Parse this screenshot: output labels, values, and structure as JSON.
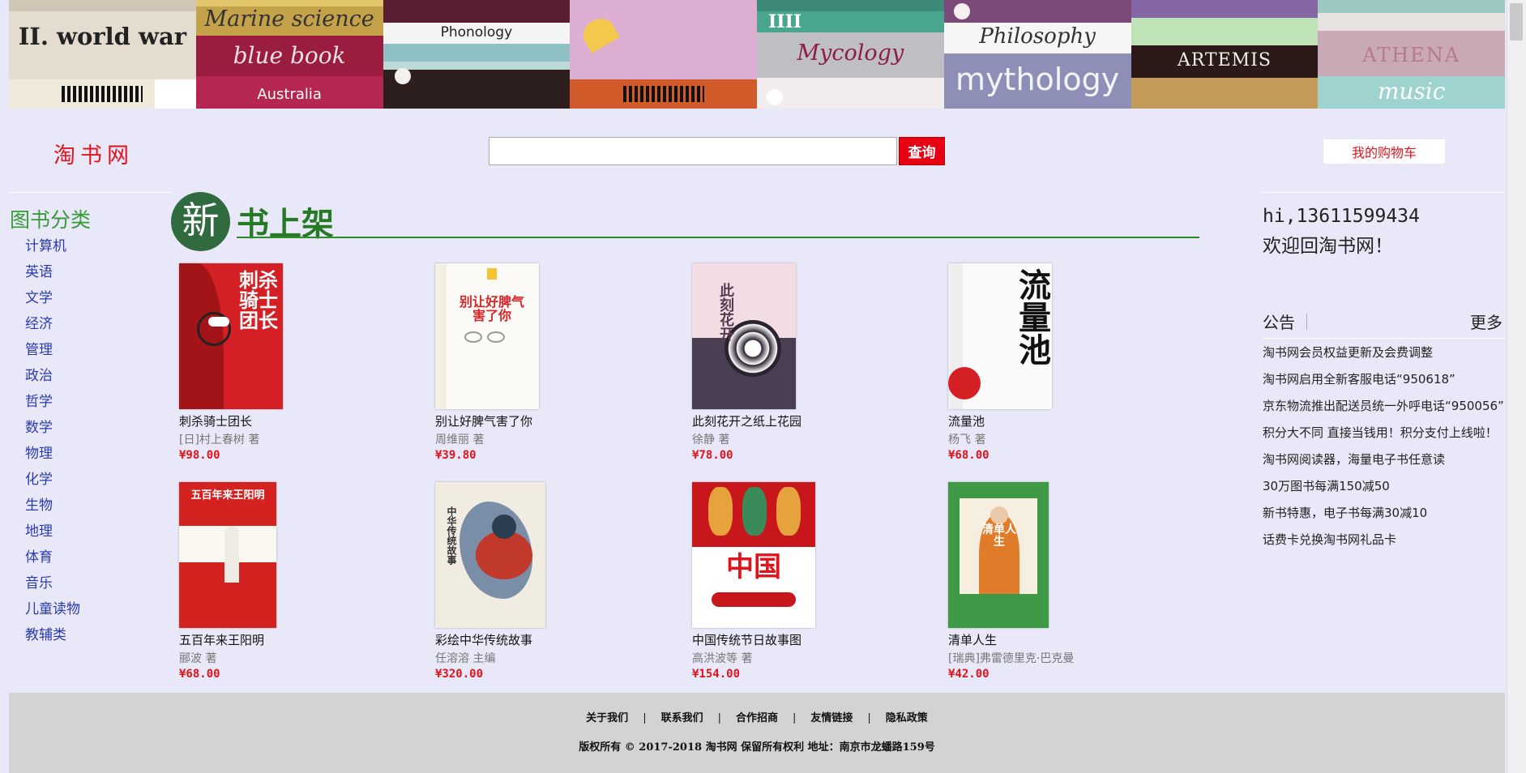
{
  "banner": {
    "books": [
      {
        "main": "II. world war",
        "sub": ""
      },
      {
        "main": "Marine science",
        "sub": "blue book",
        "extra": "Australia"
      },
      {
        "main": "Phonology",
        "sub": ""
      },
      {
        "main": "",
        "sub": ""
      },
      {
        "main": "Mycology",
        "sub": "IIII"
      },
      {
        "main": "Philosophy",
        "sub": "mythology"
      },
      {
        "main": "ARTEMIS",
        "sub": ""
      },
      {
        "main": "ATHENA",
        "sub": "music"
      }
    ]
  },
  "header": {
    "logo": "淘书网",
    "search_placeholder": "",
    "search_button": "查询",
    "cart_button": "我的购物车"
  },
  "sidebar": {
    "title": "图书分类",
    "categories": [
      "计算机",
      "英语",
      "文学",
      "经济",
      "管理",
      "政治",
      "哲学",
      "数学",
      "物理",
      "化学",
      "生物",
      "地理",
      "体育",
      "音乐",
      "儿童读物",
      "教辅类"
    ]
  },
  "shelf": {
    "badge": "新",
    "title": "书上架"
  },
  "books": [
    {
      "title": "刺杀骑士团长",
      "author": "[日]村上春树 著",
      "price": "¥98.00",
      "cover_text": "刺杀骑士团长"
    },
    {
      "title": "别让好脾气害了你",
      "author": "周维丽 著",
      "price": "¥39.80",
      "cover_text": "别让好脾气害了你"
    },
    {
      "title": "此刻花开之纸上花园",
      "author": "徐静 著",
      "price": "¥78.00",
      "cover_text": "此刻花开"
    },
    {
      "title": "流量池",
      "author": "杨飞 著",
      "price": "¥68.00",
      "cover_text": "流量池"
    },
    {
      "title": "五百年来王阳明",
      "author": "郦波 著",
      "price": "¥68.00",
      "cover_text": "五百年来王阳明"
    },
    {
      "title": "彩绘中华传统故事",
      "author": "任溶溶 主编",
      "price": "¥320.00",
      "cover_text": "中华传统故事"
    },
    {
      "title": "中国传统节日故事图",
      "author": "高洪波等 著",
      "price": "¥154.00",
      "cover_text": "中国"
    },
    {
      "title": "清单人生",
      "author": "[瑞典]弗雷德里克·巴克曼",
      "price": "¥42.00",
      "cover_text": "清单人生"
    }
  ],
  "user": {
    "greeting": "hi,13611599434",
    "welcome": "欢迎回淘书网！"
  },
  "notices": {
    "label": "公告",
    "more": "更多",
    "items": [
      "淘书网会员权益更新及会费调整",
      "淘书网启用全新客服电话“950618”",
      "京东物流推出配送员统一外呼电话“950056”",
      "积分大不同 直接当钱用！积分支付上线啦！",
      "淘书网阅读器，海量电子书任意读",
      "30万图书每满150减50",
      "新书特惠，电子书每满30减10",
      "话费卡兑换淘书网礼品卡"
    ]
  },
  "footer": {
    "links": [
      "关于我们",
      "联系我们",
      "合作招商",
      "友情链接",
      "隐私政策"
    ],
    "copyright": "版权所有 © 2017-2018 淘书网 保留所有权利 地址：南京市龙蟠路159号"
  }
}
